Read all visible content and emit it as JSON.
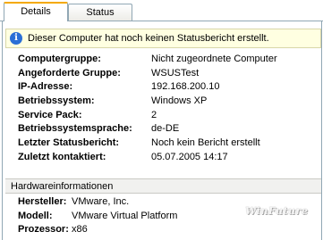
{
  "tabs": [
    {
      "label": "Details",
      "selected": true
    },
    {
      "label": "Status",
      "selected": false
    }
  ],
  "info_banner": {
    "icon": "info-icon",
    "text": "Dieser Computer hat noch keinen Statusbericht erstellt."
  },
  "properties": [
    {
      "label": "Computergruppe:",
      "value": "Nicht zugeordnete Computer"
    },
    {
      "label": "Angeforderte Gruppe:",
      "value": "WSUSTest"
    },
    {
      "label": "IP-Adresse:",
      "value": "192.168.200.10"
    },
    {
      "label": "Betriebssystem:",
      "value": "Windows XP"
    },
    {
      "label": "Service Pack:",
      "value": "2"
    },
    {
      "label": "Betriebssystemsprache:",
      "value": "de-DE"
    },
    {
      "label": "Letzter Statusbericht:",
      "value": "Noch kein Bericht erstellt"
    },
    {
      "label": "Zuletzt kontaktiert:",
      "value": "05.07.2005 14:17"
    }
  ],
  "hardware": {
    "title": "Hardwareinformationen",
    "rows": [
      {
        "label": "Hersteller:",
        "value": "VMware, Inc."
      },
      {
        "label": "Modell:",
        "value": "VMware Virtual Platform"
      },
      {
        "label": "Prozessor:",
        "value": "x86"
      }
    ]
  },
  "watermark": "WinFuture",
  "colors": {
    "tab_accent": "#f4a900",
    "info_background": "#ffffe1",
    "info_icon": "#2b6fd6"
  }
}
